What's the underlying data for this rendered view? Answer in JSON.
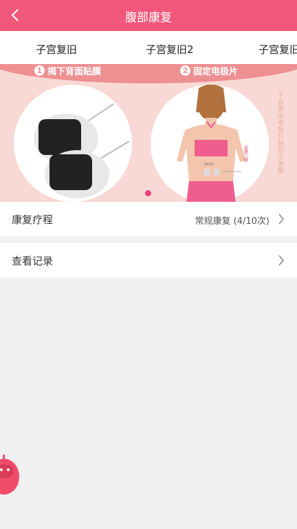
{
  "header": {
    "title": "腹部康复",
    "back_icon": "chevron-left-icon",
    "color": "#f2587b"
  },
  "tabs": [
    {
      "label": "子宫复旧"
    },
    {
      "label": "子宫复旧2"
    },
    {
      "label": "子宫复旧"
    }
  ],
  "banner": {
    "step1": {
      "num": "1",
      "label": "揭下背面贴膜"
    },
    "step2": {
      "num": "2",
      "label": "固定电极片"
    },
    "side_note": "子宫复旧电极片粘贴示意图",
    "measure_label": "3cm",
    "acupoint_label": "后腰八髎",
    "pager_active_color": "#e8457a"
  },
  "rows": {
    "course": {
      "label": "康复疗程",
      "value": "常规康复 (4/10次)"
    },
    "records": {
      "label": "查看记录"
    }
  },
  "assistant_icon": "robot-assistant-icon"
}
